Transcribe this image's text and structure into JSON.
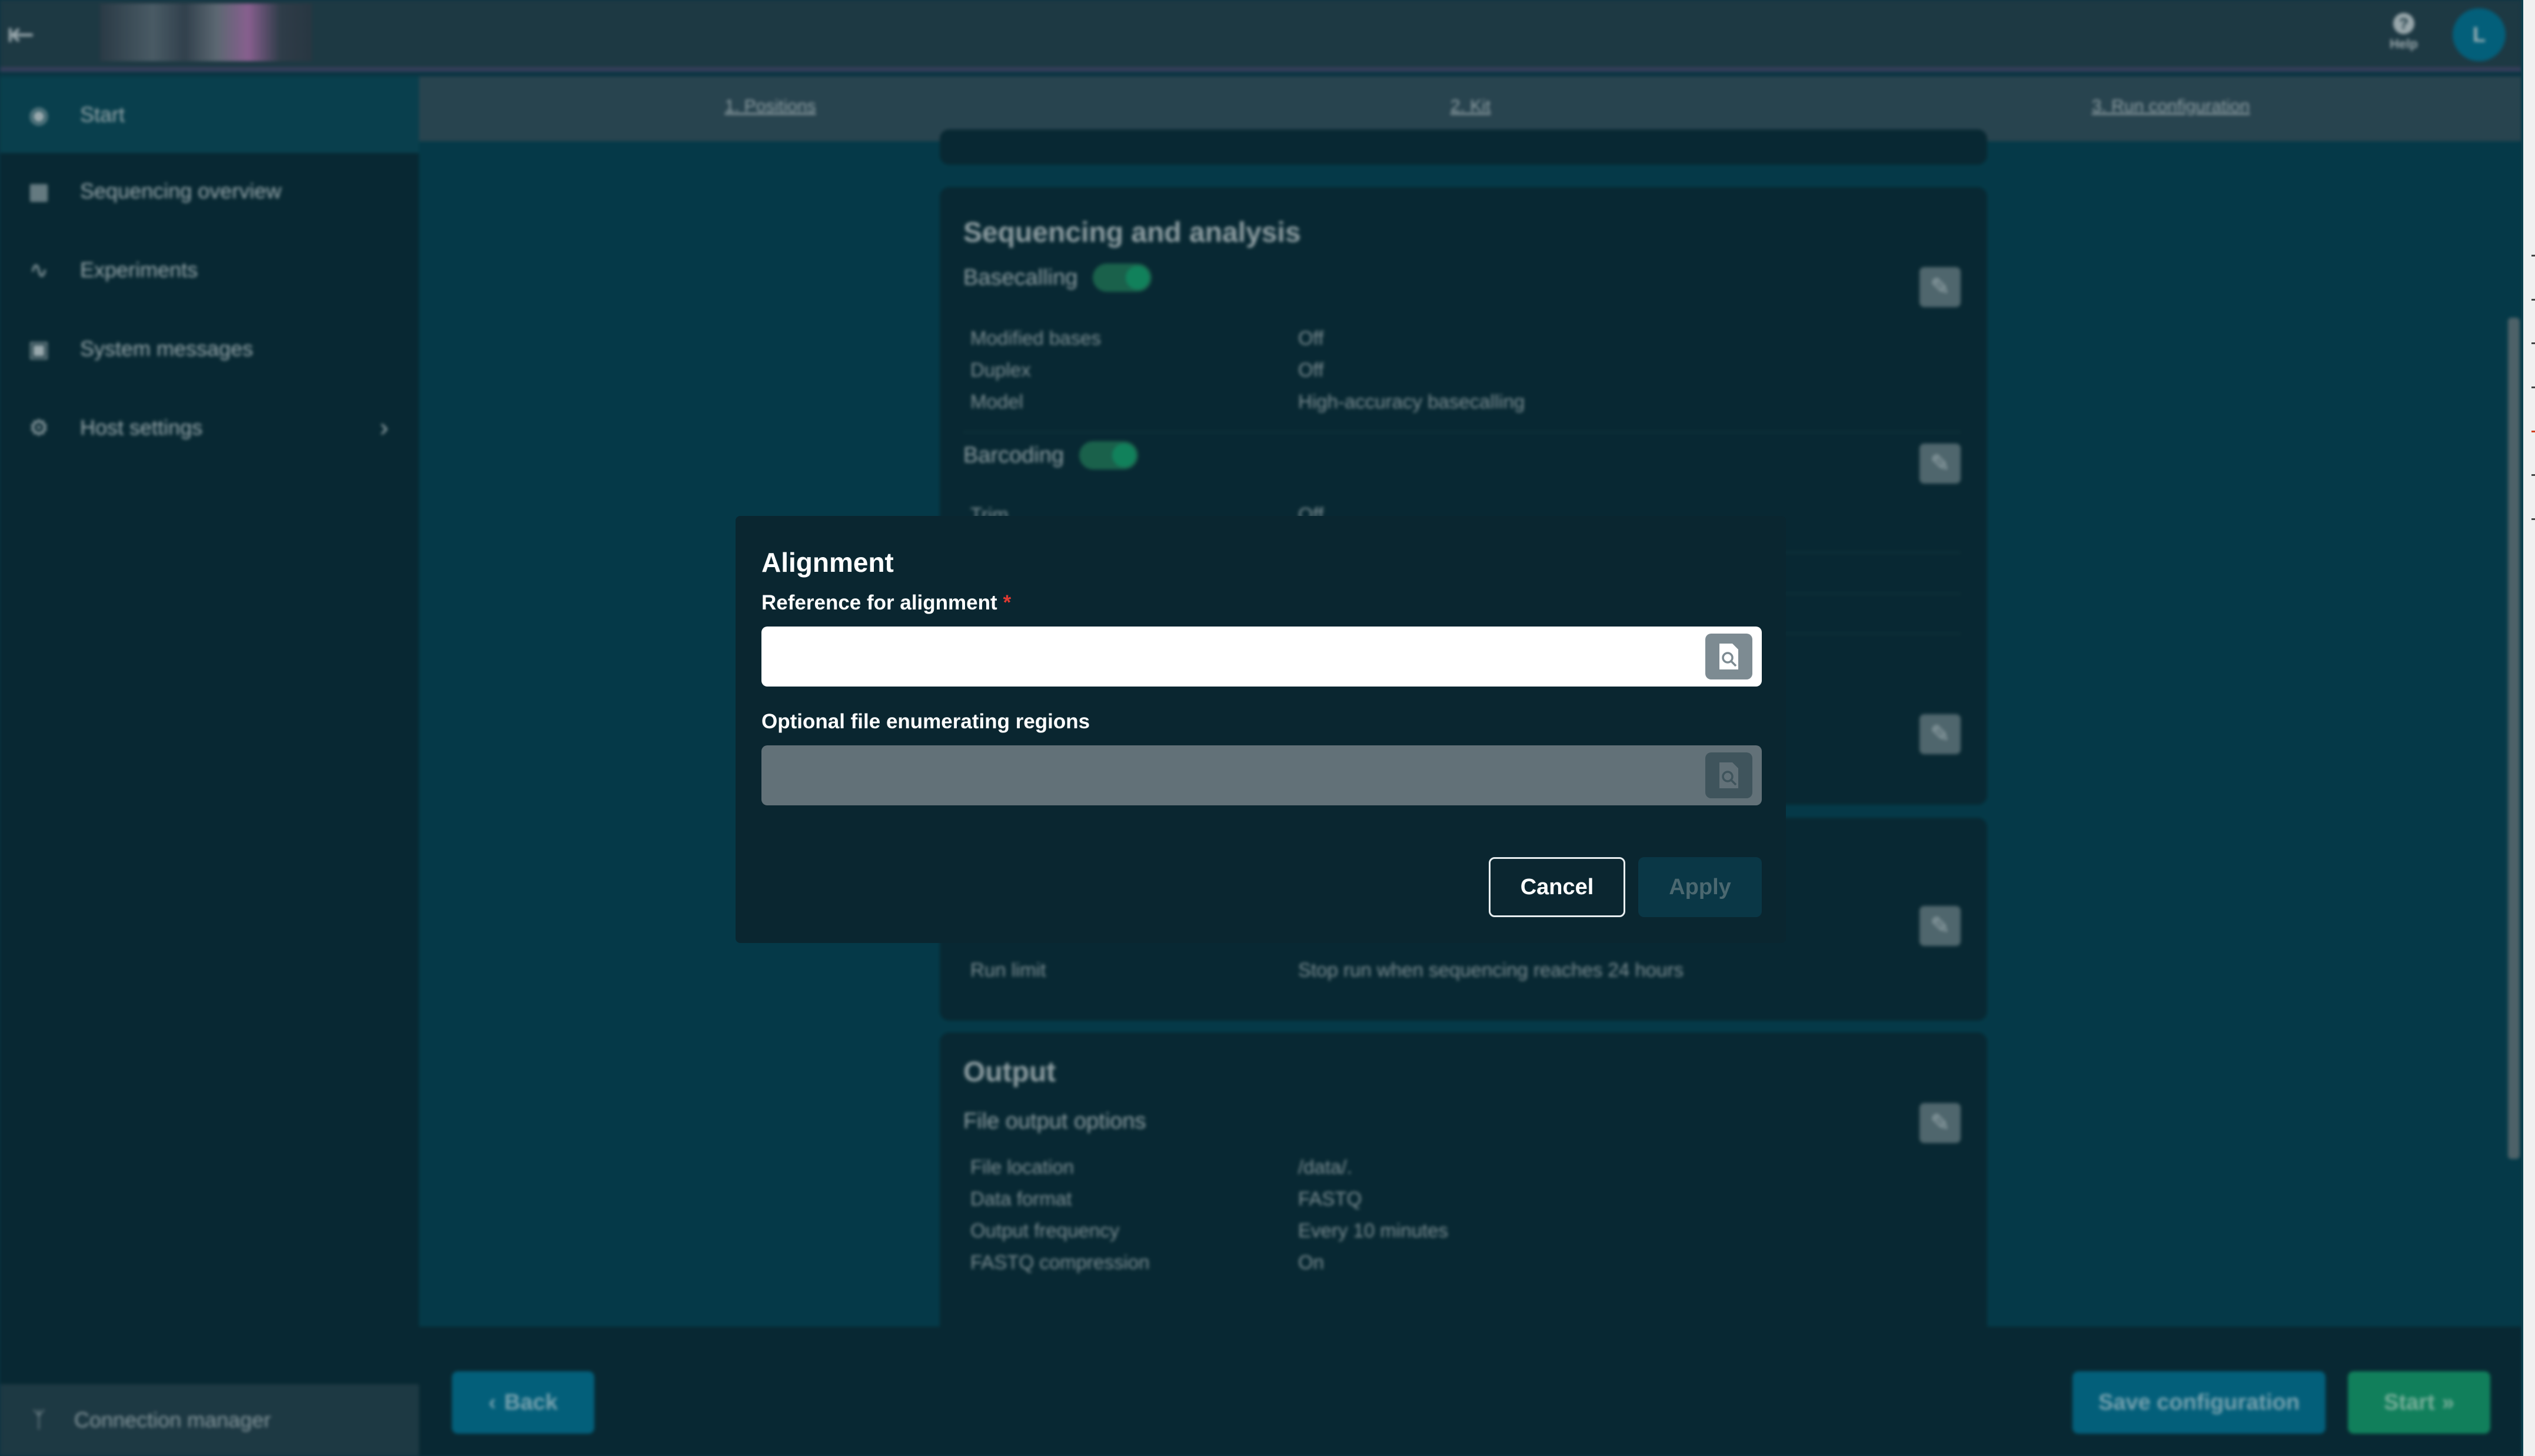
{
  "header": {
    "menu_icon": "menu-collapse-icon",
    "help_label": "Help",
    "help_icon": "help-circle-icon",
    "avatar_initial": "L"
  },
  "sidebar": {
    "items": [
      {
        "label": "Start",
        "icon": "start-icon",
        "active": true
      },
      {
        "label": "Sequencing overview",
        "icon": "grid-icon"
      },
      {
        "label": "Experiments",
        "icon": "trend-icon"
      },
      {
        "label": "System messages",
        "icon": "message-icon"
      },
      {
        "label": "Host settings",
        "icon": "gear-icon",
        "has_submenu": true
      }
    ],
    "connection_manager": "Connection manager"
  },
  "tabs": [
    {
      "label": "1. Positions"
    },
    {
      "label": "2. Kit"
    },
    {
      "label": "3. Run configuration"
    }
  ],
  "cards": {
    "sequencing": {
      "title": "Sequencing and analysis",
      "basecalling": {
        "label": "Basecalling",
        "enabled": true,
        "rows": [
          {
            "key": "Modified bases",
            "value": "Off"
          },
          {
            "key": "Duplex",
            "value": "Off"
          },
          {
            "key": "Model",
            "value": "High-accuracy basecalling"
          }
        ]
      },
      "barcoding": {
        "label": "Barcoding",
        "enabled": true,
        "rows": [
          {
            "key": "Trim",
            "value": "Off"
          }
        ]
      }
    },
    "run_options": {
      "rows": [
        {
          "key": "Run limit",
          "value": "Stop run when sequencing reaches 24 hours"
        }
      ]
    },
    "output": {
      "title": "Output",
      "subtitle": "File output options",
      "rows": [
        {
          "key": "File location",
          "value": "/data/."
        },
        {
          "key": "Data format",
          "value": "FASTQ"
        },
        {
          "key": "Output frequency",
          "value": "Every 10 minutes"
        },
        {
          "key": "FASTQ compression",
          "value": "On"
        }
      ]
    }
  },
  "footer": {
    "back_label": "Back",
    "save_label": "Save configuration",
    "start_label": "Start"
  },
  "modal": {
    "title": "Alignment",
    "reference": {
      "label": "Reference for alignment",
      "required_mark": "*",
      "value": "",
      "placeholder": ""
    },
    "regions": {
      "label": "Optional file enumerating regions",
      "value": "",
      "placeholder": "",
      "disabled": true
    },
    "cancel_label": "Cancel",
    "apply_label": "Apply"
  }
}
